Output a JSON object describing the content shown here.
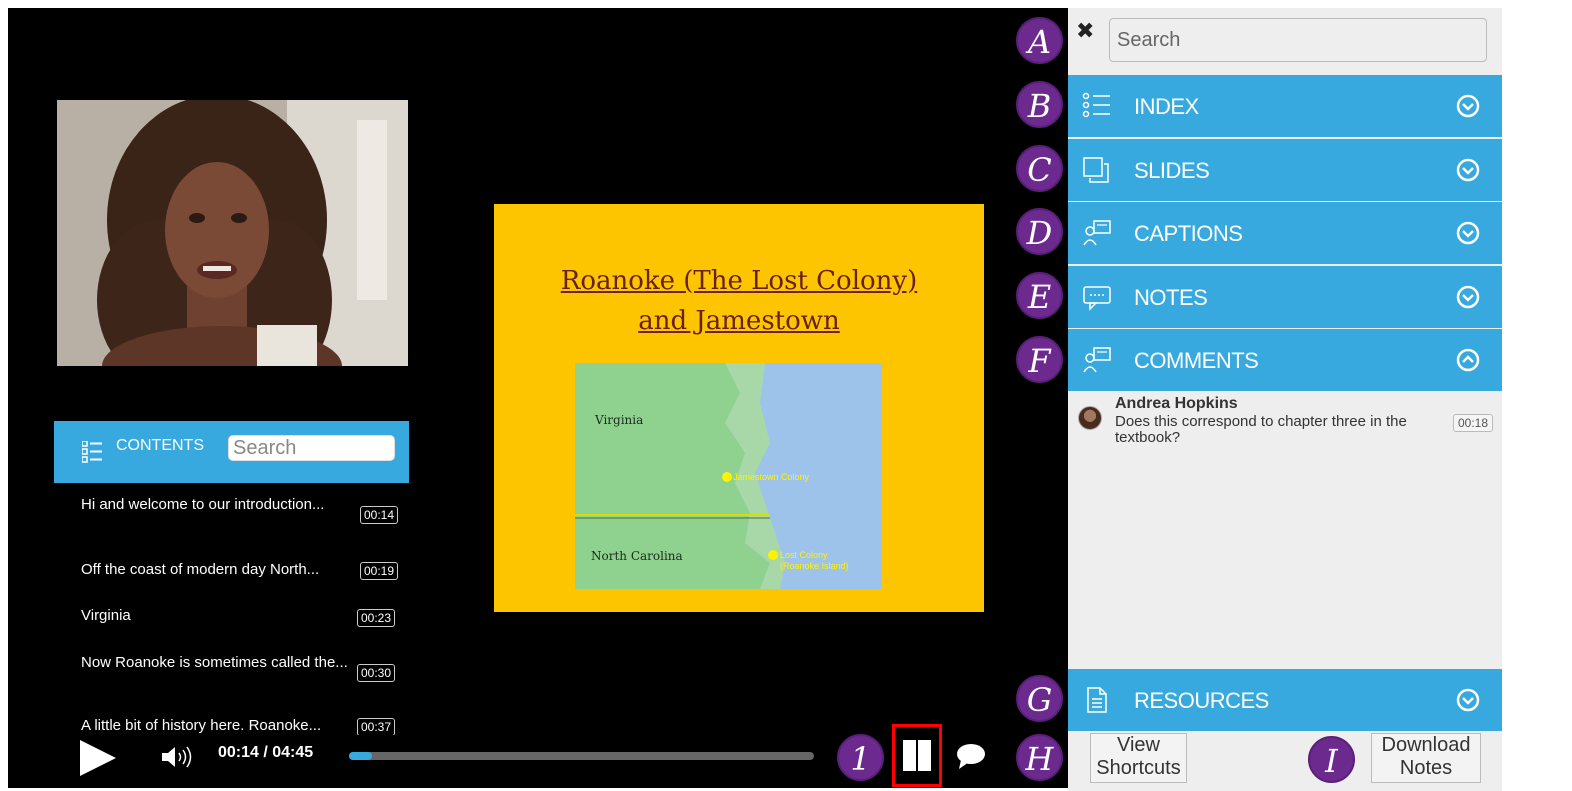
{
  "player": {
    "slide": {
      "title_line1": "Roanoke (The Lost Colony)",
      "title_line2": "and Jamestown",
      "map_labels": {
        "virginia": "Virginia",
        "north_carolina": "North Carolina",
        "jamestown": "Jamestown Colony",
        "lost_colony_line1": "Lost Colony",
        "lost_colony_line2": "(Roanoke Island)"
      }
    },
    "contents": {
      "title": "CONTENTS",
      "search_placeholder": "Search",
      "items": [
        {
          "text": "Hi and welcome to our introduction...",
          "time": "00:14"
        },
        {
          "text": "Off the coast of modern day North...",
          "time": "00:19"
        },
        {
          "text": "Virginia",
          "time": "00:23"
        },
        {
          "text": "Now Roanoke is sometimes called the...",
          "time": "00:30"
        },
        {
          "text": "A little bit of history here. Roanoke...",
          "time": "00:37"
        }
      ]
    },
    "controls": {
      "current_time": "00:14",
      "duration": "04:45",
      "time_display": "00:14 / 04:45",
      "progress_fraction": 0.049
    }
  },
  "side_panel": {
    "search_placeholder": "Search",
    "sections": [
      {
        "label": "INDEX",
        "icon": "list-icon",
        "expanded": false
      },
      {
        "label": "SLIDES",
        "icon": "slides-icon",
        "expanded": false
      },
      {
        "label": "CAPTIONS",
        "icon": "captions-icon",
        "expanded": false
      },
      {
        "label": "NOTES",
        "icon": "notes-icon",
        "expanded": false
      },
      {
        "label": "COMMENTS",
        "icon": "comments-icon",
        "expanded": true
      },
      {
        "label": "RESOURCES",
        "icon": "document-icon",
        "expanded": false
      }
    ],
    "comment": {
      "author": "Andrea Hopkins",
      "text": "Does this correspond to chapter three in the textbook?",
      "time": "00:18"
    },
    "view_shortcuts_label": "View Shortcuts",
    "download_notes_label": "Download Notes"
  },
  "annotations": {
    "A": "A",
    "B": "B",
    "C": "C",
    "D": "D",
    "E": "E",
    "F": "F",
    "G": "G",
    "H": "H",
    "I": "I",
    "one": "1"
  },
  "colors": {
    "accent": "#37a9de",
    "marker": "#6c2a8f",
    "slide_bg": "#fdc500",
    "highlight": "#ff0000"
  }
}
